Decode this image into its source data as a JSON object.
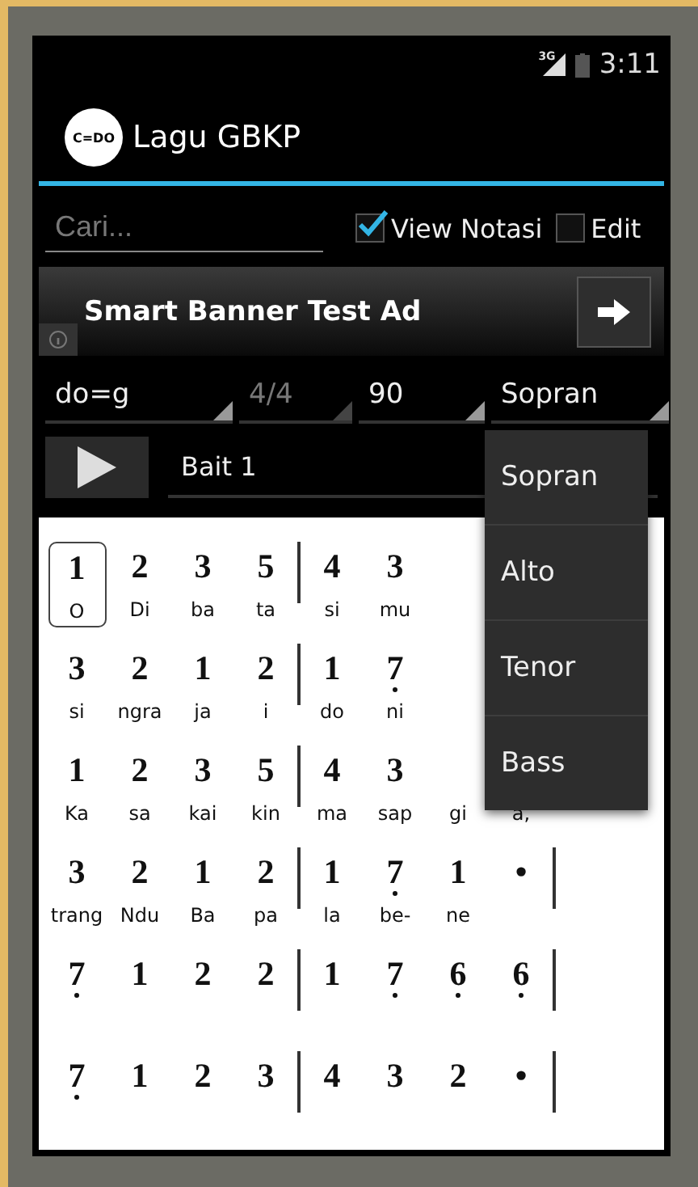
{
  "status_bar": {
    "network": "3G",
    "time": "3:11"
  },
  "app_bar": {
    "logo": "C=DO",
    "title": "Lagu GBKP"
  },
  "search": {
    "placeholder": "Cari..."
  },
  "options": [
    {
      "label": "View Notasi",
      "checked": true
    },
    {
      "label": "Edit",
      "checked": false
    }
  ],
  "ad_banner": {
    "text": "Smart Banner Test Ad"
  },
  "spinners": [
    {
      "value": "do=g",
      "disabled": false
    },
    {
      "value": "4/4",
      "disabled": true
    },
    {
      "value": "90",
      "disabled": false
    },
    {
      "value": "Sopran",
      "disabled": false
    }
  ],
  "verse": {
    "value": "Bait 1"
  },
  "notation": [
    {
      "measures": [
        [
          {
            "note": "1",
            "lyric": "O",
            "low": false,
            "selected": true
          },
          {
            "note": "2",
            "lyric": "Di",
            "low": false,
            "selected": false
          },
          {
            "note": "3",
            "lyric": "ba",
            "low": false,
            "selected": false
          },
          {
            "note": "5",
            "lyric": "ta",
            "low": false,
            "selected": false
          }
        ],
        [
          {
            "note": "4",
            "lyric": "si",
            "low": false,
            "selected": false
          },
          {
            "note": "3",
            "lyric": "mu",
            "low": false,
            "selected": false
          }
        ]
      ]
    },
    {
      "measures": [
        [
          {
            "note": "3",
            "lyric": "si",
            "low": false,
            "selected": false
          },
          {
            "note": "2",
            "lyric": "ngra",
            "low": false,
            "selected": false
          },
          {
            "note": "1",
            "lyric": "ja",
            "low": false,
            "selected": false
          },
          {
            "note": "2",
            "lyric": "i",
            "low": false,
            "selected": false
          }
        ],
        [
          {
            "note": "1",
            "lyric": "do",
            "low": false,
            "selected": false
          },
          {
            "note": "7",
            "lyric": "ni",
            "low": true,
            "selected": false
          }
        ]
      ]
    },
    {
      "measures": [
        [
          {
            "note": "1",
            "lyric": "Ka",
            "low": false,
            "selected": false
          },
          {
            "note": "2",
            "lyric": "sa",
            "low": false,
            "selected": false
          },
          {
            "note": "3",
            "lyric": "kai",
            "low": false,
            "selected": false
          },
          {
            "note": "5",
            "lyric": "kin",
            "low": false,
            "selected": false
          }
        ],
        [
          {
            "note": "4",
            "lyric": "ma",
            "low": false,
            "selected": false
          },
          {
            "note": "3",
            "lyric": "sap",
            "low": false,
            "selected": false
          },
          {
            "lyric": "gi",
            "selected": false
          },
          {
            "lyric": "a,",
            "selected": false
          }
        ]
      ]
    },
    {
      "measures": [
        [
          {
            "note": "3",
            "lyric": "trang",
            "low": false,
            "selected": false
          },
          {
            "note": "2",
            "lyric": "Ndu",
            "low": false,
            "selected": false
          },
          {
            "note": "1",
            "lyric": "Ba",
            "low": false,
            "selected": false
          },
          {
            "note": "2",
            "lyric": "pa",
            "low": false,
            "selected": false
          }
        ],
        [
          {
            "note": "1",
            "lyric": "la",
            "low": false,
            "selected": false
          },
          {
            "note": "7",
            "lyric": "be-",
            "low": true,
            "selected": false
          },
          {
            "note": "1",
            "lyric": "ne",
            "low": false,
            "selected": false
          },
          {
            "note": "•",
            "low": false,
            "selected": false
          }
        ]
      ]
    },
    {
      "measures": [
        [
          {
            "note": "7",
            "low": true,
            "selected": false
          },
          {
            "note": "1",
            "low": false,
            "selected": false
          },
          {
            "note": "2",
            "low": false,
            "selected": false
          },
          {
            "note": "2",
            "low": false,
            "selected": false
          }
        ],
        [
          {
            "note": "1",
            "low": false,
            "selected": false
          },
          {
            "note": "7",
            "low": true,
            "selected": false
          },
          {
            "note": "6",
            "low": true,
            "selected": false
          },
          {
            "note": "6",
            "low": true,
            "selected": false
          }
        ]
      ]
    },
    {
      "measures": [
        [
          {
            "note": "7",
            "low": true,
            "selected": false
          },
          {
            "note": "1",
            "low": false,
            "selected": false
          },
          {
            "note": "2",
            "low": false,
            "selected": false
          },
          {
            "note": "3",
            "low": false,
            "selected": false
          }
        ],
        [
          {
            "note": "4",
            "low": false,
            "selected": false
          },
          {
            "note": "3",
            "low": false,
            "selected": false
          },
          {
            "note": "2",
            "low": false,
            "selected": false
          },
          {
            "note": "•",
            "low": false,
            "selected": false
          }
        ]
      ]
    }
  ],
  "dropdown": {
    "items": [
      "Sopran",
      "Alto",
      "Tenor",
      "Bass"
    ]
  }
}
